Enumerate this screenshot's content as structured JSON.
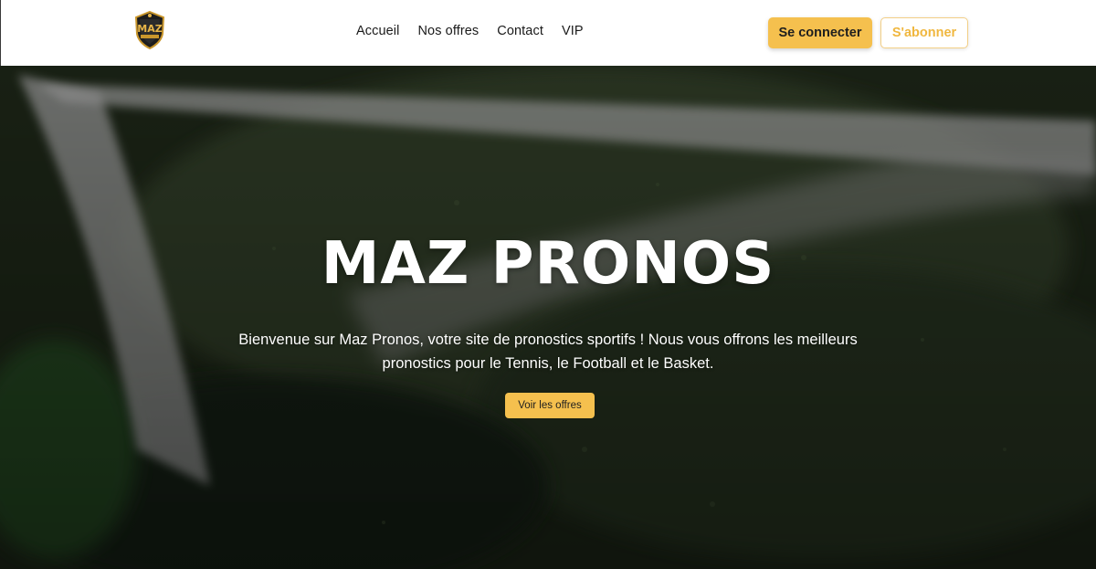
{
  "brand": {
    "logo_text": "MAZ",
    "logo_icon": "shield-crest-logo",
    "accent": "#f5c04e"
  },
  "nav": {
    "items": [
      {
        "label": "Accueil"
      },
      {
        "label": "Nos offres"
      },
      {
        "label": "Contact"
      },
      {
        "label": "VIP"
      }
    ]
  },
  "header": {
    "login_label": "Se connecter",
    "subscribe_label": "S'abonner"
  },
  "hero": {
    "title": "MAZ PRONOS",
    "description": "Bienvenue sur Maz Pronos, votre site de pronostics sportifs ! Nous vous offrons les meilleurs pronostics pour le Tennis, le Football et le Basket.",
    "cta_label": "Voir les offres",
    "background": "grass-field-photo"
  }
}
